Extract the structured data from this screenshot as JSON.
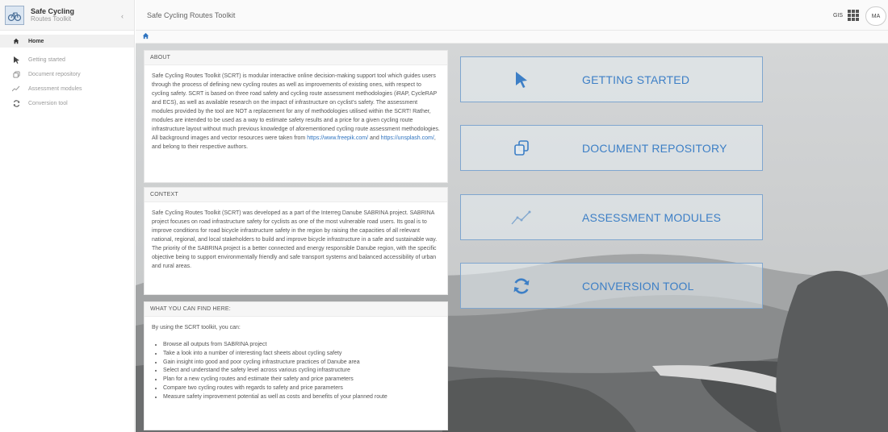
{
  "brand": {
    "name": "Safe Cycling",
    "subtitle": "Routes Toolkit"
  },
  "sidebar": {
    "collapse_glyph": "‹",
    "items": [
      {
        "label": "Home",
        "icon": "home-icon",
        "active": true
      },
      {
        "label": "Getting started",
        "icon": "cursor-icon"
      },
      {
        "label": "Document repository",
        "icon": "copy-icon"
      },
      {
        "label": "Assessment modules",
        "icon": "chart-line-icon"
      },
      {
        "label": "Conversion tool",
        "icon": "refresh-icon"
      }
    ]
  },
  "topbar": {
    "title": "Safe Cycling Routes Toolkit",
    "gis_label": "GIS",
    "avatar_initials": "MA"
  },
  "panels": {
    "about": {
      "title": "ABOUT",
      "text_pre": "Safe Cycling Routes Toolkit (SCRT) is modular interactive online decision-making support tool which guides users through the process of defining new cycling routes as well as improvements of existing ones, with respect to cycling safety. SCRT is based on three road safety and cycling route assessment methodologies (iRAP, CycleRAP and ECS), as well as available research on the impact of infrastructure on cyclist's safety. The assessment modules provided by the tool are NOT a replacement for any of methodologies utilised within the SCRT! Rather, modules are intended to be used as a way to estimate safety results and a price for a given cycling route infrastructure layout without much previous knowledge of aforementioned cycling route assessment methodologies. All background images and vector resources were taken from",
      "link1": "https://www.freepik.com/",
      "text_mid": "and",
      "link2": "https://unsplash.com/",
      "text_post": ", and belong to their respective authors."
    },
    "context": {
      "title": "CONTEXT",
      "text": "Safe Cycling Routes Toolkit (SCRT) was developed as a part of the Interreg Danube SABRINA project. SABRINA project focuses on road infrastructure safety for cyclists as one of the most vulnerable road users. Its goal is to improve conditions for road bicycle infrastructure safety in the region by raising the capacities of all relevant national, regional, and local stakeholders to build and improve bicycle infrastructure in a safe and sustainable way. The priority of the SABRINA project is a better connected and energy responsible Danube region, with the specific objective being to support environmentally friendly and safe transport systems and balanced accessibility of urban and rural areas."
    },
    "find": {
      "title": "WHAT YOU CAN FIND HERE:",
      "intro": "By using the SCRT toolkit, you can:",
      "items": [
        "Browse all outputs from SABRINA project",
        "Take a look into a number of interesting fact sheets about cycling safety",
        "Gain insight into good and poor cycling infrastructure practices of Danube area",
        "Select and understand the safety level across various cycling infrastructure",
        "Plan for a new cycling routes and estimate their safety and price parameters",
        "Compare two cycling routes with regards to safety and price parameters",
        "Measure safety improvement potential as well as costs and benefits of your planned route"
      ]
    }
  },
  "tiles": [
    {
      "label": "GETTING STARTED",
      "icon": "cursor-icon"
    },
    {
      "label": "DOCUMENT REPOSITORY",
      "icon": "copy-icon"
    },
    {
      "label": "ASSESSMENT MODULES",
      "icon": "chart-line-icon"
    },
    {
      "label": "CONVERSION TOOL",
      "icon": "refresh-icon"
    }
  ],
  "colors": {
    "accent": "#3d7fc6",
    "tile_border": "#7fa6cf",
    "link": "#2f74c0"
  }
}
